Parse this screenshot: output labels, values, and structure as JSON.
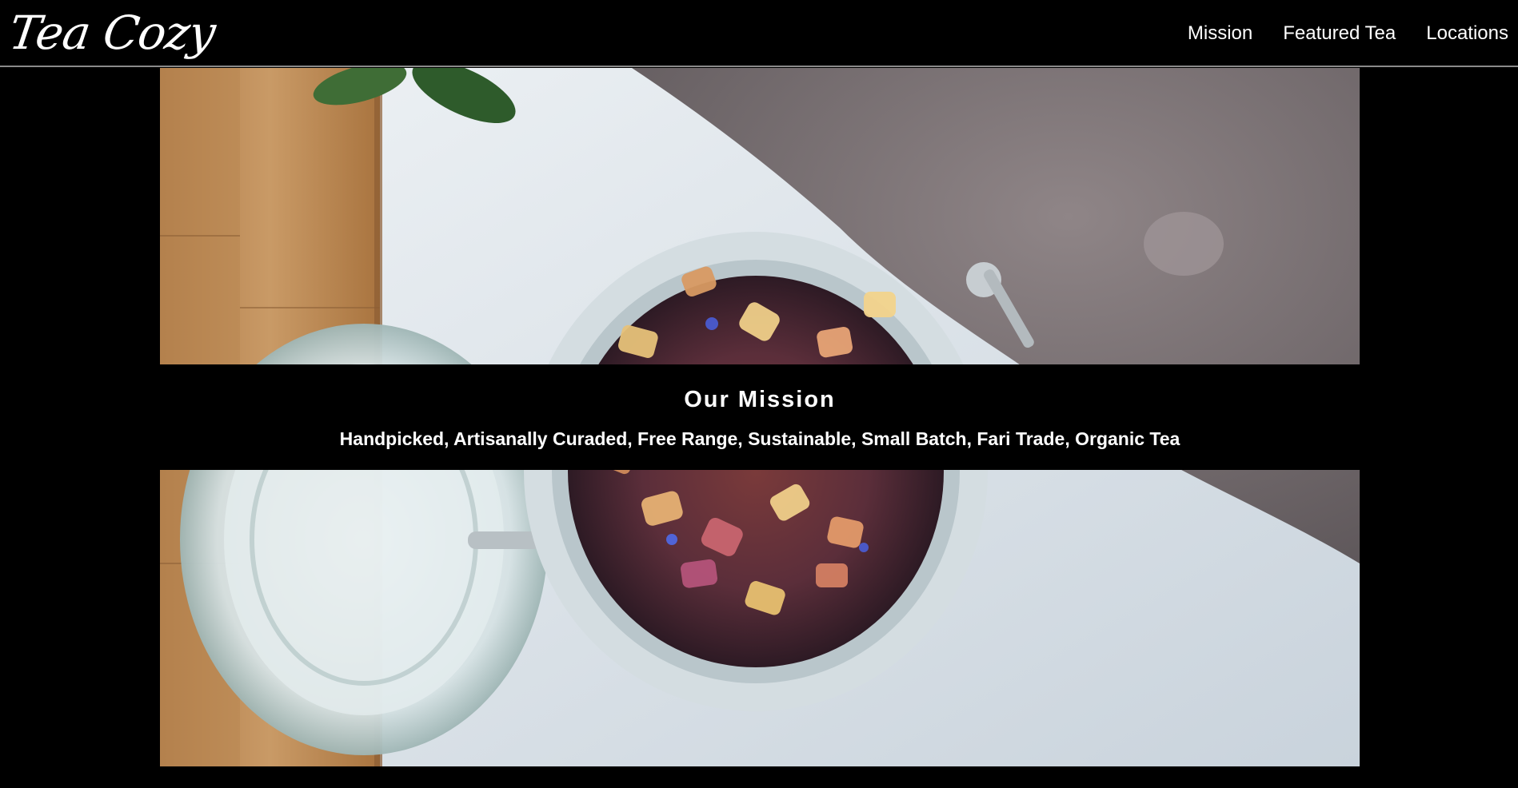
{
  "header": {
    "logo_text": "Tea Cozy",
    "nav": [
      {
        "label": "Mission"
      },
      {
        "label": "Featured Tea"
      },
      {
        "label": "Locations"
      }
    ]
  },
  "mission": {
    "title": "Our Mission",
    "tagline": "Handpicked, Artisanally Curaded, Free Range, Sustainable, Small Batch, Fari Trade, Organic Tea"
  },
  "hero_image": {
    "subject": "open glass jar of loose-leaf herbal tea on white table with wooden board and grey knit blanket"
  },
  "colors": {
    "background": "#000000",
    "text": "#ffffff",
    "header_border": "#8a8a8a"
  }
}
